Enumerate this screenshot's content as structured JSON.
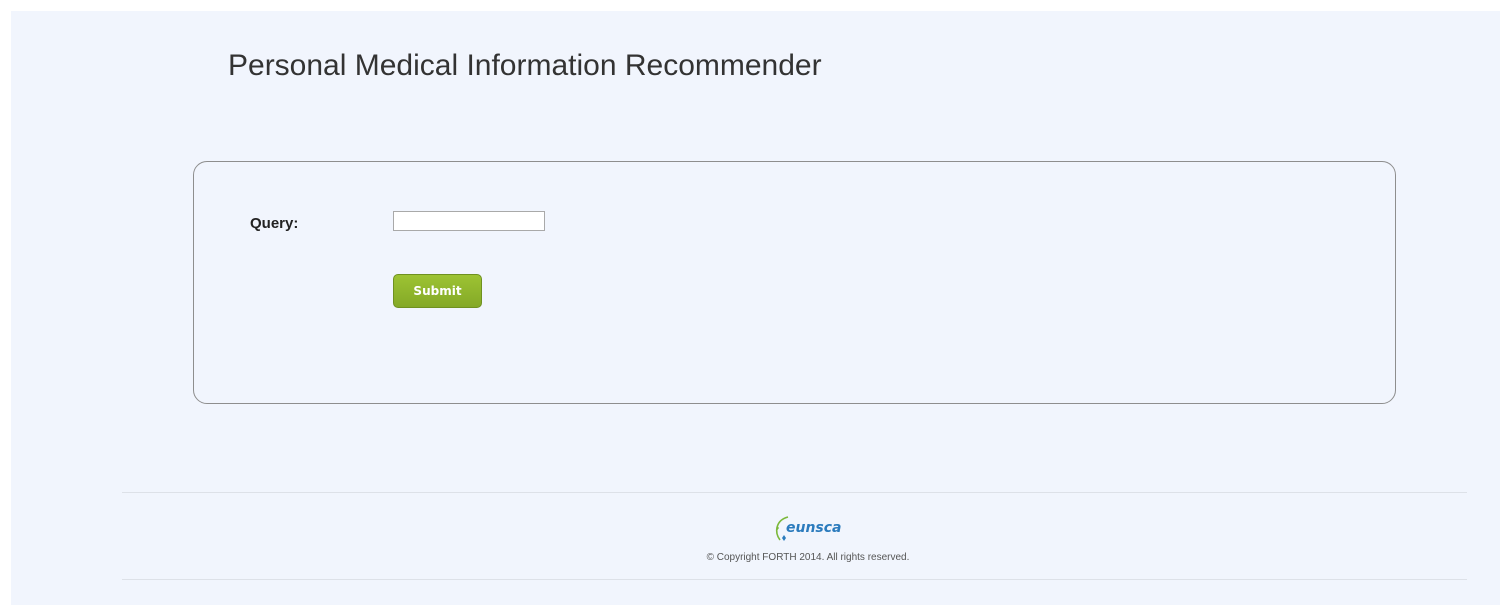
{
  "header": {
    "title": "Personal Medical Information Recommender"
  },
  "form": {
    "query_label": "Query:",
    "query_value": "",
    "query_placeholder": "",
    "submit_label": "Submit"
  },
  "footer": {
    "logo_text": "eunsca",
    "copyright": "© Copyright FORTH 2014. All rights reserved."
  },
  "colors": {
    "page_background": "#f1f5fd",
    "submit_button": "#8db52d",
    "logo_blue": "#2b7bbd",
    "logo_green": "#7bb83a"
  }
}
